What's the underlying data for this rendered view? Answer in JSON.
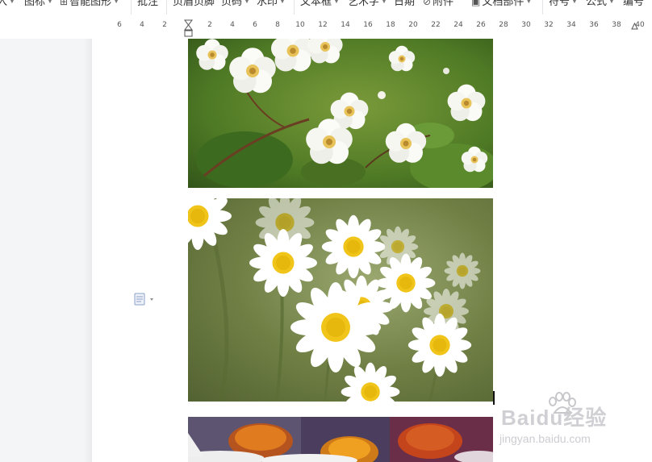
{
  "ribbon": {
    "items": [
      {
        "label": "入",
        "has_dropdown": true
      },
      {
        "label": "图标",
        "has_dropdown": true
      },
      {
        "label": "智能图形",
        "has_dropdown": true,
        "icon": "smart-art-icon"
      },
      {
        "label": "批注",
        "has_dropdown": false
      },
      {
        "label": "页眉页脚",
        "has_dropdown": false
      },
      {
        "label": "页码",
        "has_dropdown": true
      },
      {
        "label": "水印",
        "has_dropdown": true
      },
      {
        "label": "文本框",
        "has_dropdown": true
      },
      {
        "label": "艺术字",
        "has_dropdown": true
      },
      {
        "label": "日期",
        "has_dropdown": false
      },
      {
        "label": "附件",
        "has_dropdown": false,
        "icon": "attachment-icon"
      },
      {
        "label": "文档部件",
        "has_dropdown": true,
        "icon": "document-parts-icon"
      },
      {
        "label": "符号",
        "has_dropdown": true
      },
      {
        "label": "公式",
        "has_dropdown": true
      },
      {
        "label": "编号",
        "has_dropdown": false
      }
    ]
  },
  "ruler": {
    "ticks": [
      "6",
      "4",
      "2",
      "2",
      "4",
      "6",
      "8",
      "10",
      "12",
      "14",
      "16",
      "18",
      "20",
      "22",
      "24",
      "26",
      "28",
      "30",
      "32",
      "34",
      "36",
      "38",
      "40"
    ]
  },
  "document": {
    "images": [
      {
        "subject": "white rose blossoms with green leaves"
      },
      {
        "subject": "white daisies with yellow centers"
      },
      {
        "subject": "orange coneflowers with white petals"
      }
    ]
  },
  "watermark": {
    "brand": "Baidu经验",
    "url": "jingyan.baidu.com"
  },
  "colors": {
    "ribbon_bg": "#ffffff",
    "ruler_text": "#555555",
    "workspace_bg": "#f4f5f7",
    "page_bg": "#ffffff"
  }
}
